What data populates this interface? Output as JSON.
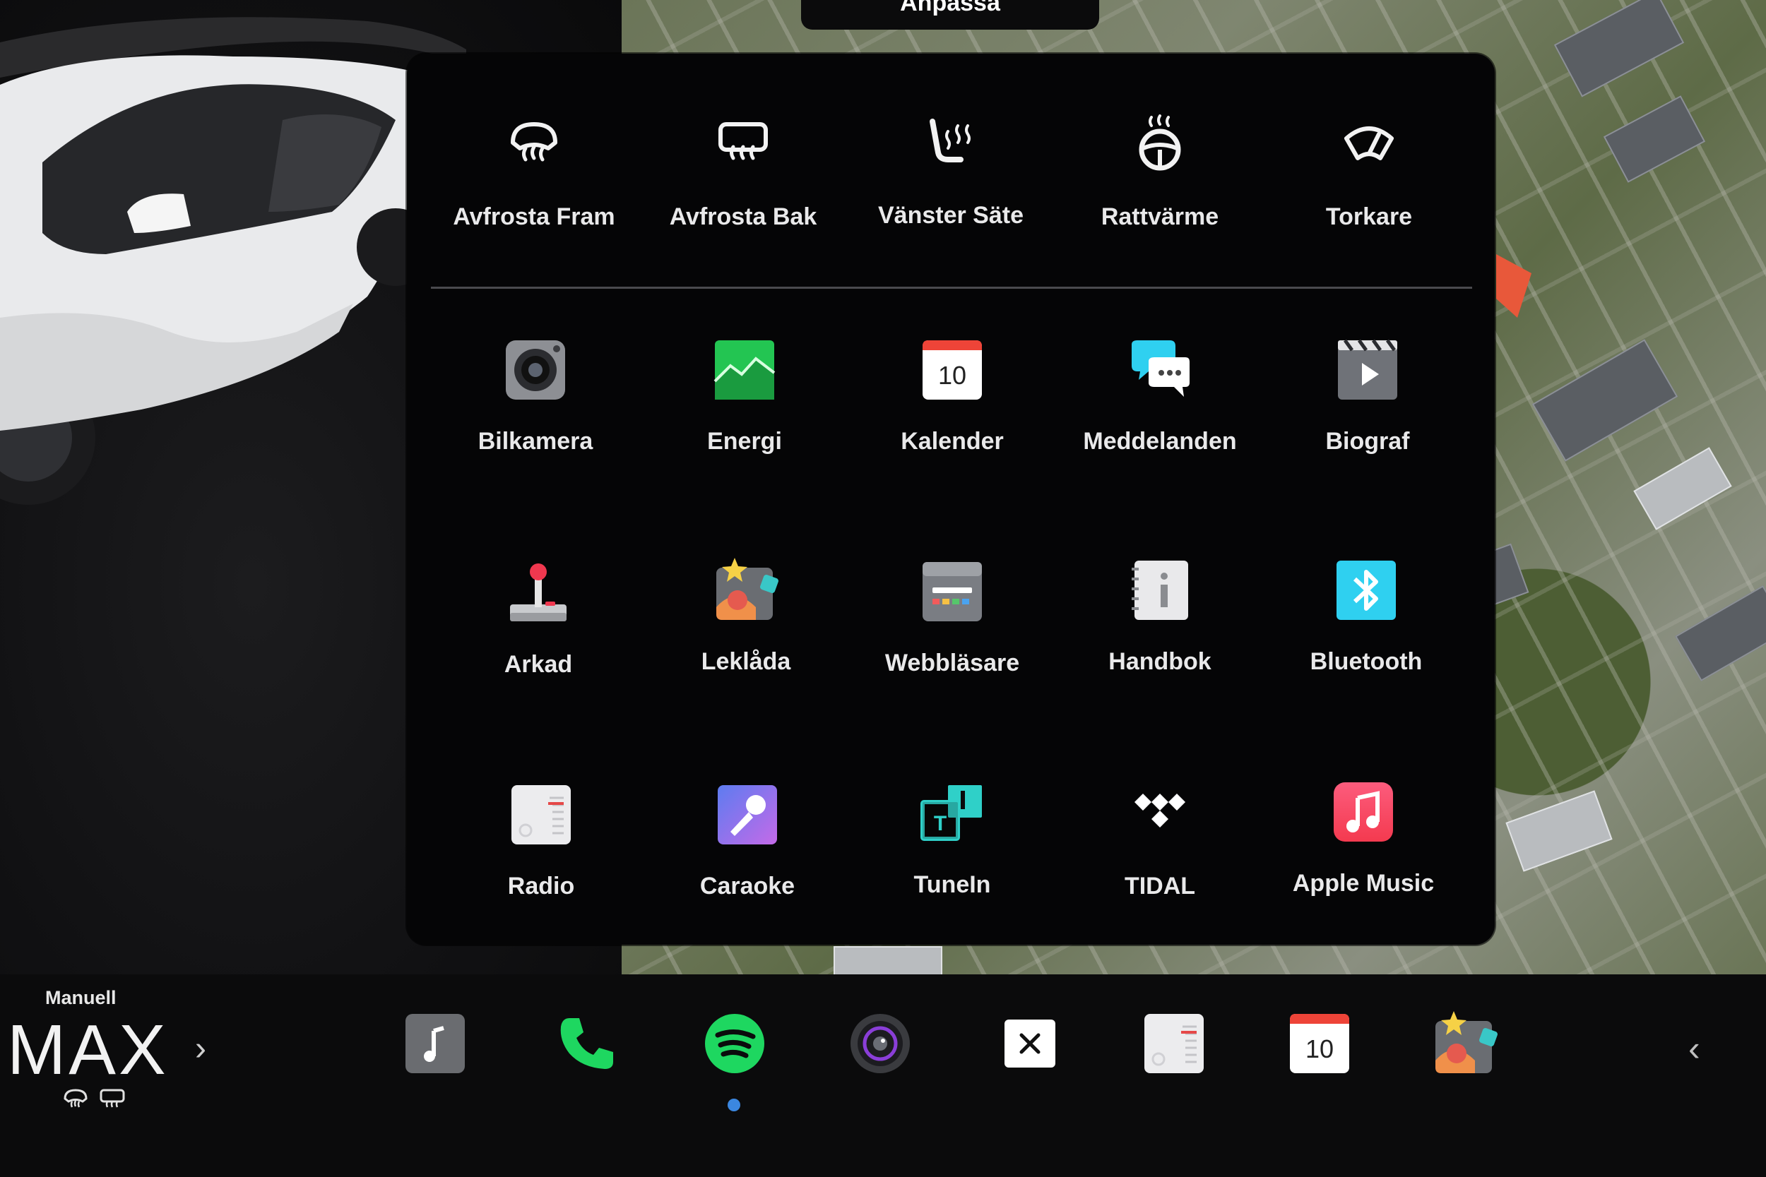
{
  "top_tab": {
    "label": "Anpassa"
  },
  "quick_controls": [
    {
      "label": "Avfrosta Fram",
      "icon": "front-defrost-icon"
    },
    {
      "label": "Avfrosta Bak",
      "icon": "rear-defrost-icon"
    },
    {
      "label": "Vänster Säte",
      "icon": "seat-heater-icon"
    },
    {
      "label": "Rattvärme",
      "icon": "steering-wheel-heat-icon"
    },
    {
      "label": "Torkare",
      "icon": "wiper-icon"
    }
  ],
  "apps": [
    {
      "label": "Bilkamera",
      "icon": "camera-icon"
    },
    {
      "label": "Energi",
      "icon": "energy-graph-icon"
    },
    {
      "label": "Kalender",
      "icon": "calendar-icon",
      "day": "10"
    },
    {
      "label": "Meddelanden",
      "icon": "messages-icon"
    },
    {
      "label": "Biograf",
      "icon": "theater-icon"
    },
    {
      "label": "Arkad",
      "icon": "joystick-icon"
    },
    {
      "label": "Leklåda",
      "icon": "toybox-icon"
    },
    {
      "label": "Webbläsare",
      "icon": "browser-icon"
    },
    {
      "label": "Handbok",
      "icon": "manual-icon"
    },
    {
      "label": "Bluetooth",
      "icon": "bluetooth-icon"
    },
    {
      "label": "Radio",
      "icon": "radio-icon"
    },
    {
      "label": "Caraoke",
      "icon": "microphone-icon"
    },
    {
      "label": "TuneIn",
      "icon": "tunein-icon"
    },
    {
      "label": "TIDAL",
      "icon": "tidal-icon"
    },
    {
      "label": "Apple Music",
      "icon": "apple-music-icon"
    }
  ],
  "climate": {
    "mode": "Manuell",
    "fan": "MAX"
  },
  "dock": {
    "items": [
      "music-icon",
      "phone-icon",
      "spotify-icon",
      "dashcam-icon",
      "close-icon",
      "radio-icon",
      "calendar-icon",
      "toybox-icon"
    ],
    "calendar_day": "10",
    "close_glyph": "×",
    "active": "spotify-icon"
  },
  "colors": {
    "accent_blue": "#3b87e0",
    "spotify_green": "#1ed760",
    "energy_green": "#23c552",
    "bluetooth_cyan": "#2fd0f0",
    "apple_music_red": "#fa3c5a"
  }
}
